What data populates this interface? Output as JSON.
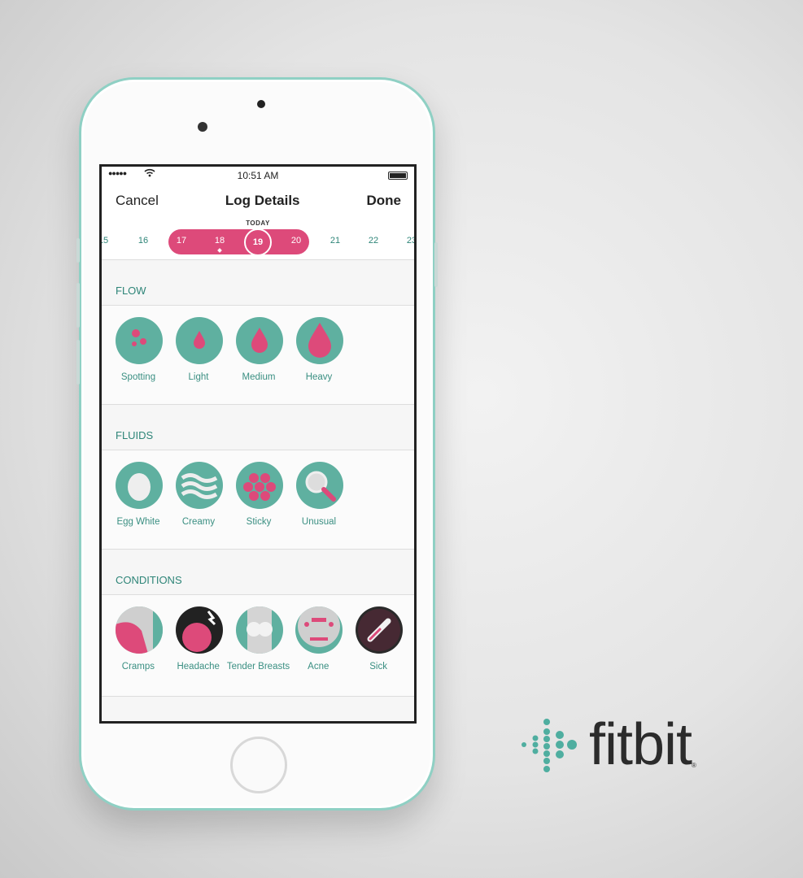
{
  "status": {
    "time": "10:51 AM"
  },
  "nav": {
    "cancel": "Cancel",
    "title": "Log Details",
    "done": "Done"
  },
  "dates": {
    "today_label": "TODAY",
    "days": [
      "15",
      "16",
      "17",
      "18",
      "19",
      "20",
      "21",
      "22",
      "23"
    ],
    "selected": "19",
    "period_range": [
      "17",
      "20"
    ]
  },
  "sections": [
    {
      "title": "FLOW",
      "items": [
        "Spotting",
        "Light",
        "Medium",
        "Heavy"
      ]
    },
    {
      "title": "FLUIDS",
      "items": [
        "Egg White",
        "Creamy",
        "Sticky",
        "Unusual"
      ]
    },
    {
      "title": "CONDITIONS",
      "items": [
        "Cramps",
        "Headache",
        "Tender Breasts",
        "Acne",
        "Sick"
      ]
    }
  ],
  "brand": {
    "name": "fitbit",
    "reg": "®"
  },
  "colors": {
    "teal": "#5fb0a0",
    "pink": "#dd4a7a",
    "text_teal": "#2e8578"
  }
}
